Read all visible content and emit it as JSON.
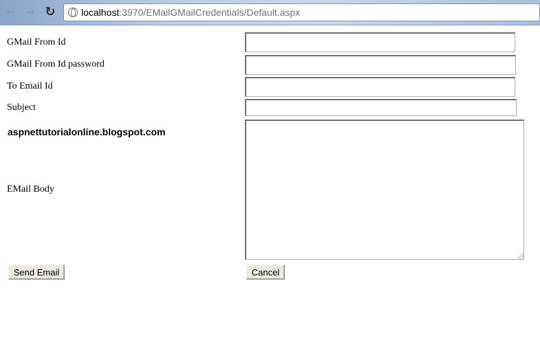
{
  "browser": {
    "url_host": "localhost",
    "url_path": ":3970/EMailGMailCredentials/Default.aspx"
  },
  "form": {
    "from_label": "GMail From Id",
    "password_label": "GMail From Id password",
    "to_label": "To Email Id",
    "subject_label": "Subject",
    "brand_text": "aspnettutorialonline.blogspot.com",
    "body_label": "EMail Body",
    "send_label": "Send Email",
    "cancel_label": "Cancel"
  }
}
